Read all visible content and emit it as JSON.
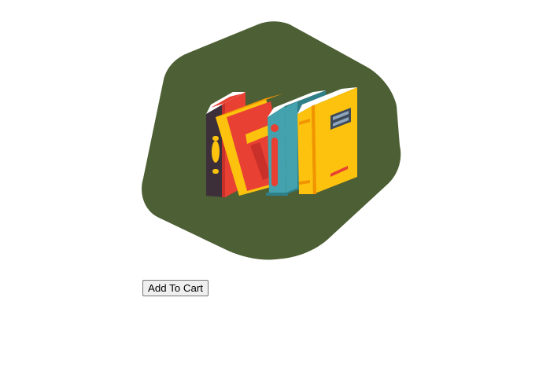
{
  "product": {
    "image_icon": "books-icon",
    "colors": {
      "badge": "#4d5f34",
      "book_red": "#e84033",
      "book_dark": "#3d2f3a",
      "book_yellow": "#fcc20e",
      "book_teal": "#43a2ad",
      "book_orange": "#f29400",
      "pages": "#f3f3f3"
    }
  },
  "actions": {
    "add_to_cart_label": "Add To Cart"
  }
}
